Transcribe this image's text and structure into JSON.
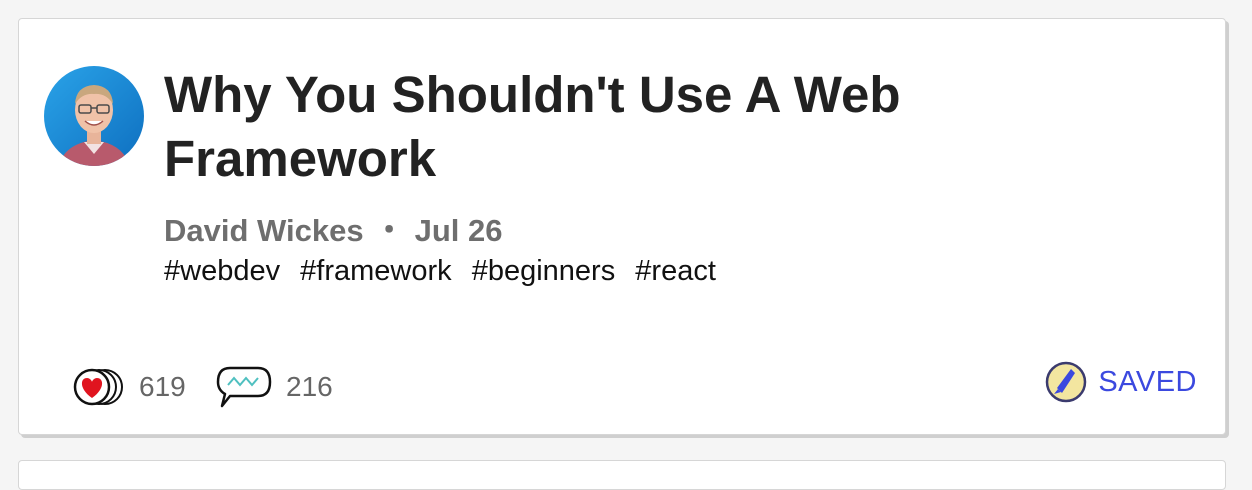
{
  "article": {
    "title": "Why You Shouldn't Use A Web Framework",
    "author": "David Wickes",
    "separator": "・",
    "date": "Jul 26",
    "tags": [
      "#webdev",
      "#framework",
      "#beginners",
      "#react"
    ],
    "reactions_count": "619",
    "comments_count": "216",
    "saved_label": "SAVED"
  },
  "icons": {
    "avatar": "author-avatar",
    "reactions": "heart-reactions-icon",
    "comments": "comment-bubble-icon",
    "saved": "bookmark-saved-icon"
  },
  "colors": {
    "accent": "#3b49df",
    "heart": "#e0141f",
    "comment_wave": "#4fc0c0",
    "saved_badge": "#f3e6a0"
  }
}
